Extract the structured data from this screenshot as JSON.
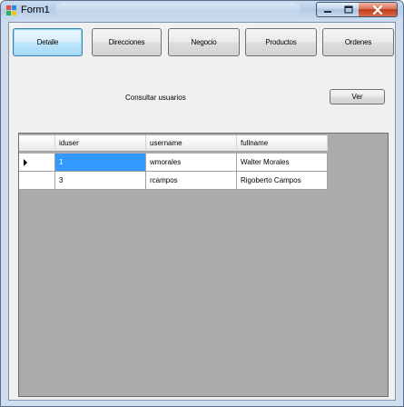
{
  "window": {
    "title": "Form1"
  },
  "colors": {
    "selection": "#3399ff",
    "grid_background": "#ababab",
    "close_button": "#c2391a"
  },
  "toolbar": {
    "tabs": [
      {
        "label": "Detalle",
        "active": true
      },
      {
        "label": "Direcciones",
        "active": false
      },
      {
        "label": "Negocio",
        "active": false
      },
      {
        "label": "Productos",
        "active": false
      },
      {
        "label": "Ordenes",
        "active": false
      }
    ]
  },
  "consult": {
    "label": "Consultar usuarios",
    "button_label": "Ver"
  },
  "grid": {
    "columns": [
      "iduser",
      "username",
      "fullname"
    ],
    "rows": [
      {
        "iduser": "1",
        "username": "wmorales",
        "fullname": "Walter Morales",
        "current": true
      },
      {
        "iduser": "3",
        "username": "rcampos",
        "fullname": "Rigoberto Campos",
        "current": false
      }
    ]
  }
}
